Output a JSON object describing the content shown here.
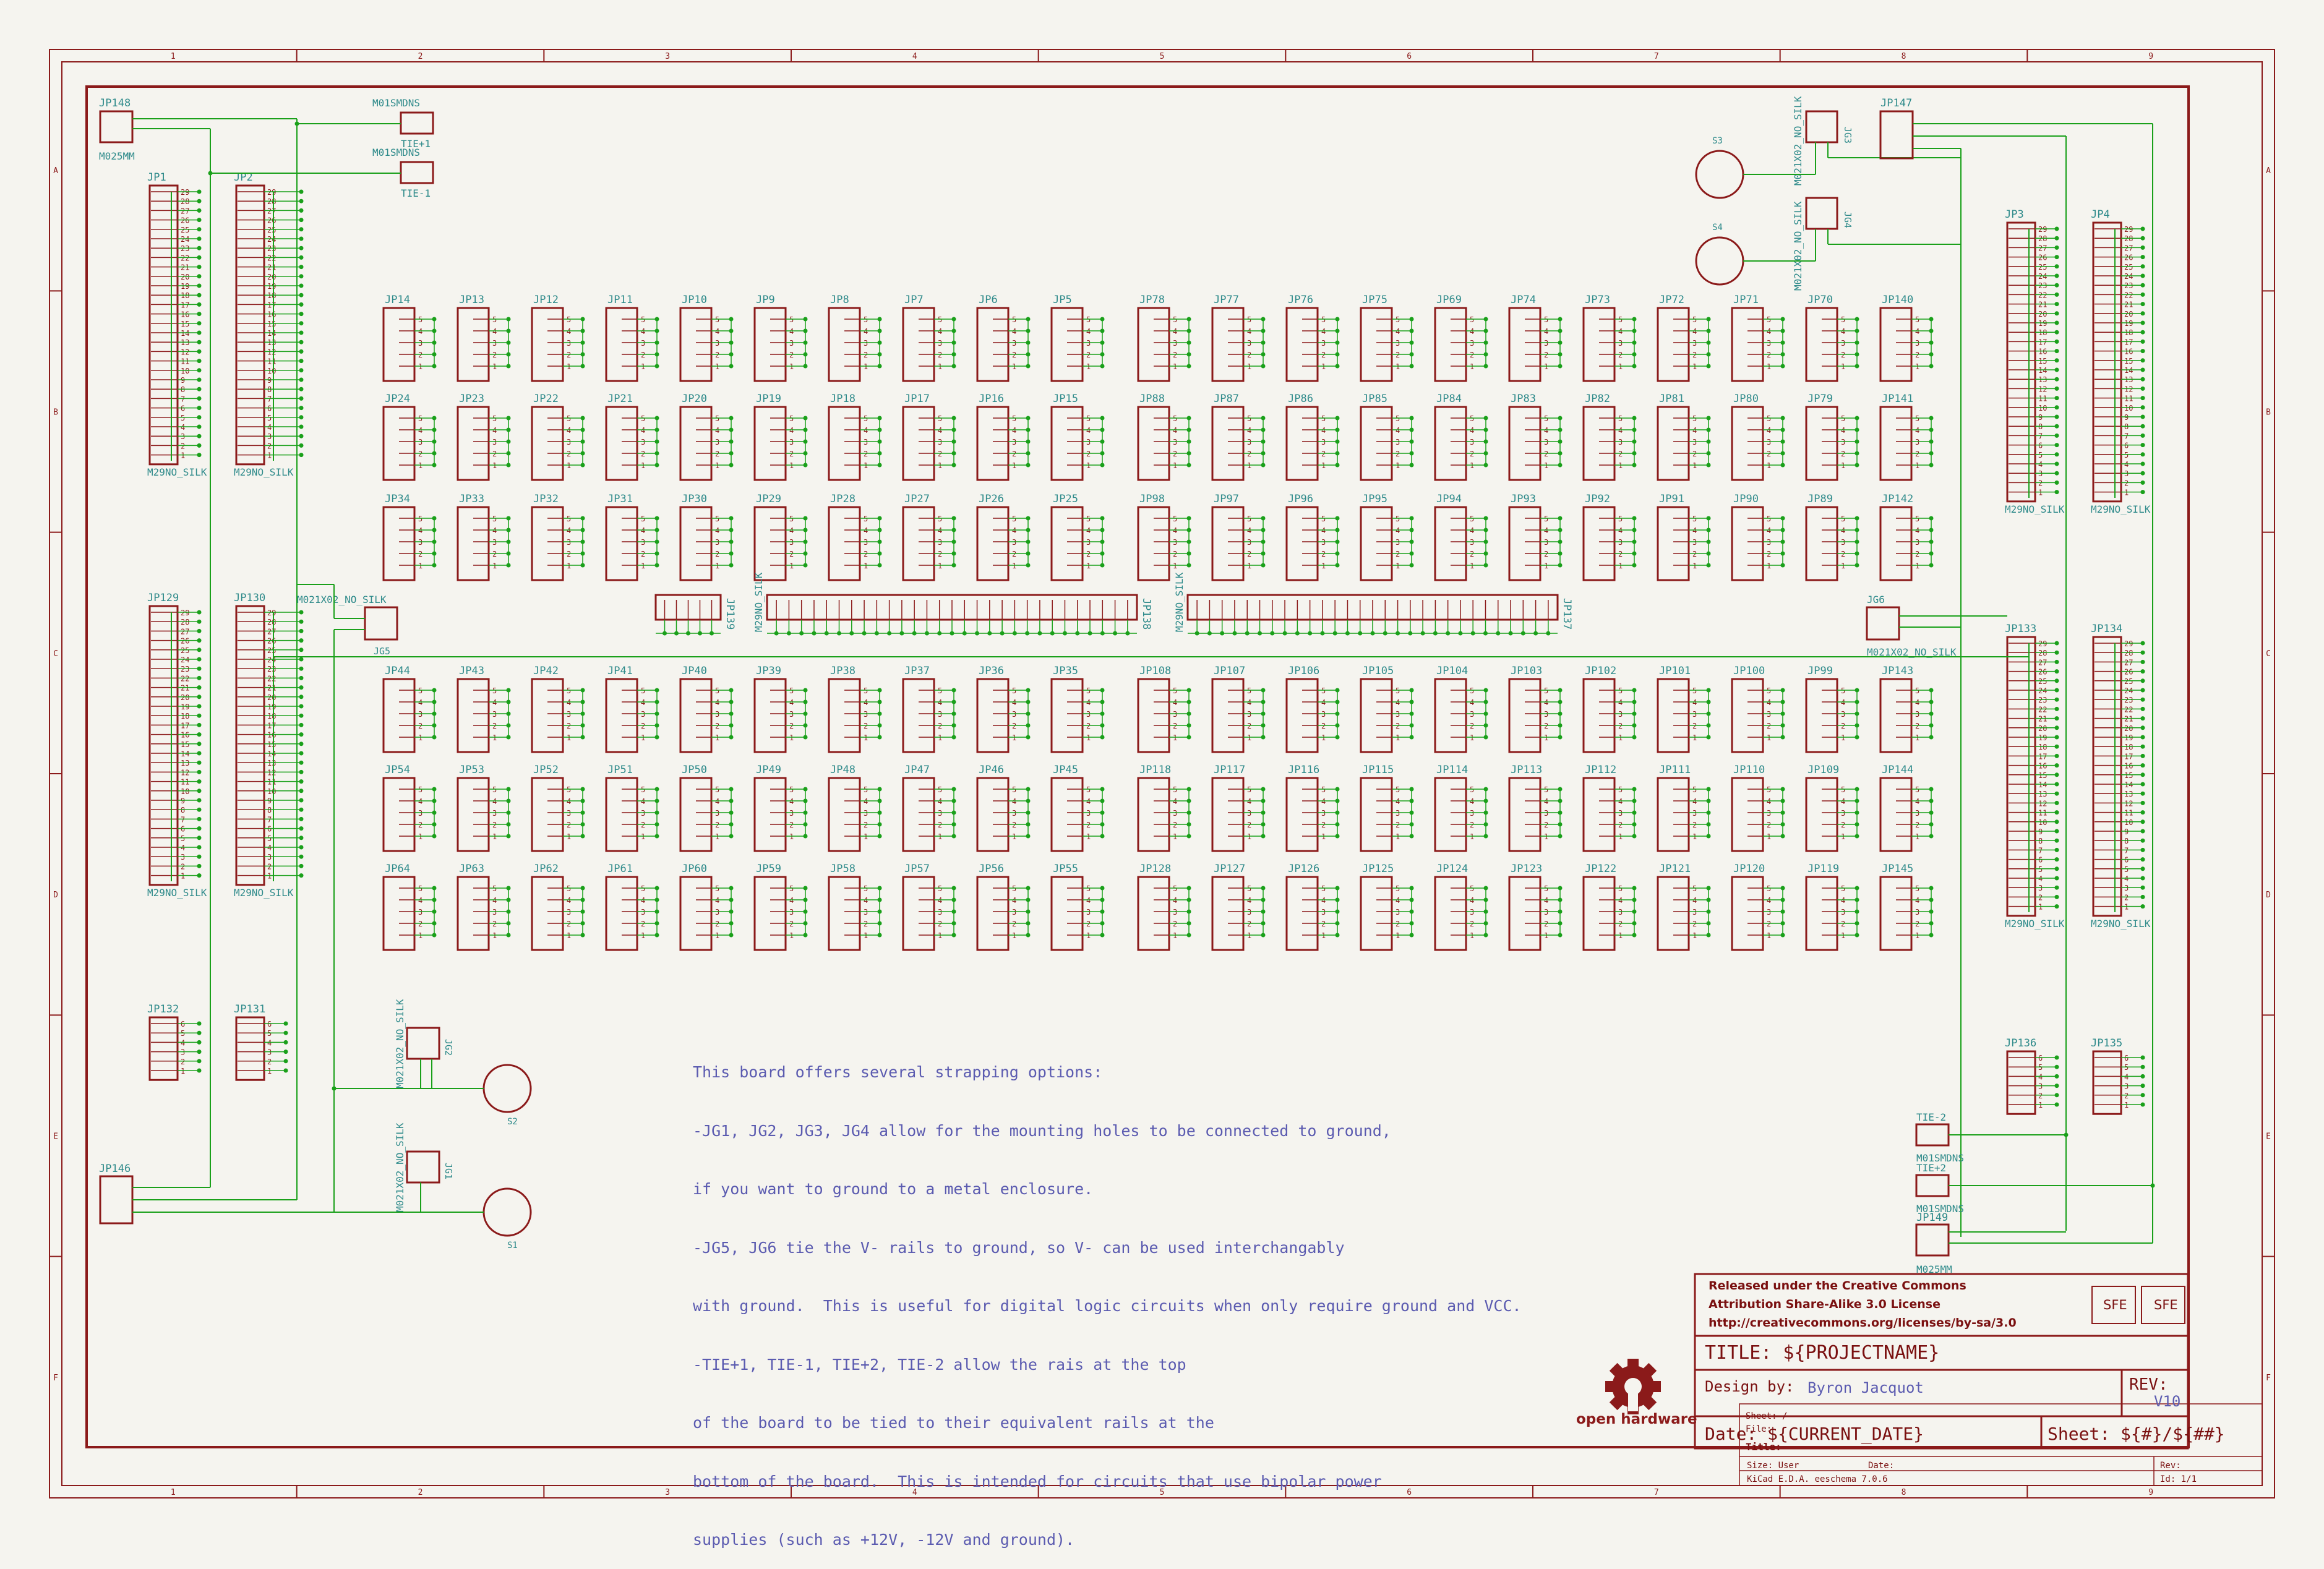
{
  "colors": {
    "frame": "#8b1a1a",
    "comp": "#8b1a1a",
    "wire": "#1aa01a",
    "label": "#2e8a8a",
    "pin": "#8b1a1a",
    "note": "#5b5bb0",
    "background": "#f5f4ef"
  },
  "border": {
    "col_labels": [
      "1",
      "2",
      "3",
      "4",
      "5",
      "6",
      "7",
      "8",
      "9"
    ],
    "row_labels": [
      "A",
      "B",
      "C",
      "D",
      "E",
      "F"
    ]
  },
  "left_headers": [
    {
      "ref": "JP1",
      "value": "M29NO_SILK"
    },
    {
      "ref": "JP2",
      "value": "M29NO_SILK"
    },
    {
      "ref": "JP129",
      "value": "M29NO_SILK"
    },
    {
      "ref": "JP130",
      "value": "M29NO_SILK"
    }
  ],
  "right_headers": [
    {
      "ref": "JP3",
      "value": "M29NO_SILK"
    },
    {
      "ref": "JP4",
      "value": "M29NO_SILK"
    },
    {
      "ref": "JP133",
      "value": "M29NO_SILK"
    },
    {
      "ref": "JP134",
      "value": "M29NO_SILK"
    }
  ],
  "small_left": [
    {
      "ref": "JP132"
    },
    {
      "ref": "JP131"
    }
  ],
  "small_right": [
    {
      "ref": "JP136"
    },
    {
      "ref": "JP135"
    }
  ],
  "grid_rows": [
    [
      "JP14",
      "JP13",
      "JP12",
      "JP11",
      "JP10",
      "JP9",
      "JP8",
      "JP7",
      "JP6",
      "JP5",
      "JP78",
      "JP77",
      "JP76",
      "JP75",
      "JP69",
      "JP74",
      "JP73",
      "JP72",
      "JP71",
      "JP70",
      "JP140"
    ],
    [
      "JP24",
      "JP23",
      "JP22",
      "JP21",
      "JP20",
      "JP19",
      "JP18",
      "JP17",
      "JP16",
      "JP15",
      "JP88",
      "JP87",
      "JP86",
      "JP85",
      "JP84",
      "JP83",
      "JP82",
      "JP81",
      "JP80",
      "JP79",
      "JP141"
    ],
    [
      "JP34",
      "JP33",
      "JP32",
      "JP31",
      "JP30",
      "JP29",
      "JP28",
      "JP27",
      "JP26",
      "JP25",
      "JP98",
      "JP97",
      "JP96",
      "JP95",
      "JP94",
      "JP93",
      "JP92",
      "JP91",
      "JP90",
      "JP89",
      "JP142"
    ],
    [
      "JP44",
      "JP43",
      "JP42",
      "JP41",
      "JP40",
      "JP39",
      "JP38",
      "JP37",
      "JP36",
      "JP35",
      "JP108",
      "JP107",
      "JP106",
      "JP105",
      "JP104",
      "JP103",
      "JP102",
      "JP101",
      "JP100",
      "JP99",
      "JP143"
    ],
    [
      "JP54",
      "JP53",
      "JP52",
      "JP51",
      "JP50",
      "JP49",
      "JP48",
      "JP47",
      "JP46",
      "JP45",
      "JP118",
      "JP117",
      "JP116",
      "JP115",
      "JP114",
      "JP113",
      "JP112",
      "JP111",
      "JP110",
      "JP109",
      "JP144"
    ],
    [
      "JP64",
      "JP63",
      "JP62",
      "JP61",
      "JP60",
      "JP59",
      "JP58",
      "JP57",
      "JP56",
      "JP55",
      "JP128",
      "JP127",
      "JP126",
      "JP125",
      "JP124",
      "JP123",
      "JP122",
      "JP121",
      "JP120",
      "JP119",
      "JP145"
    ]
  ],
  "misc": {
    "jp148": "JP148",
    "m025mm_a": "M025MM",
    "tie1p": "TIE+1",
    "tie1m": "TIE-1",
    "m01smdns": "M01SMDNS",
    "jp147": "JP147",
    "jg3": "JG3",
    "jg4": "JG4",
    "m021x02": "M021X02_NO_SILK",
    "s3": "S3",
    "s4": "S4",
    "s2": "S2",
    "s1": "S1",
    "jg5": "JG5",
    "jg6": "JG6",
    "jg2": "JG2",
    "jg1": "JG1",
    "jp139": "JP139",
    "jp138": "JP138",
    "jp137": "JP137",
    "m29": "M29NO_SILK",
    "jp146": "JP146",
    "jp149": "JP149",
    "m025mm_b": "M025MM",
    "tie2m": "TIE-2",
    "tie2p": "TIE+2"
  },
  "note_lines": [
    "This board offers several strapping options:",
    "-JG1, JG2, JG3, JG4 allow for the mounting holes to be connected to ground,",
    "if you want to ground to a metal enclosure.",
    "-JG5, JG6 tie the V- rails to ground, so V- can be used interchangably",
    "with ground.  This is useful for digital logic circuits when only require ground and VCC.",
    "-TIE+1, TIE-1, TIE+2, TIE-2 allow the rais at the top",
    "of the board to be tied to their equivalent rails at the",
    "bottom of the board.  This is intended for circuits that use bipolar power",
    "supplies (such as +12V, -12V and ground)."
  ],
  "title_block": {
    "license_1": "Released under the Creative Commons",
    "license_2": "Attribution Share-Alike 3.0 License",
    "license_3": "http://creativecommons.org/licenses/by-sa/3.0",
    "sfe_1": "SFE",
    "sfe_2": "SFE",
    "title": "TITLE:  ${PROJECTNAME}",
    "design_by": "Design by:",
    "designer": "Byron Jacquot",
    "rev_label": "REV:",
    "rev_value": "V10",
    "date": "Date: ${CURRENT_DATE}",
    "sheet": "Sheet: ${#}/${##}",
    "sheet_small": "Sheet: /",
    "file_small": "File:",
    "title_small": "Title:",
    "size": "Size: User",
    "date_small": "Date:",
    "rev_small": "Rev:",
    "kicad": "KiCad E.D.A.  eeschema 7.0.6",
    "id": "Id: 1/1",
    "oshw": "open hardware"
  }
}
